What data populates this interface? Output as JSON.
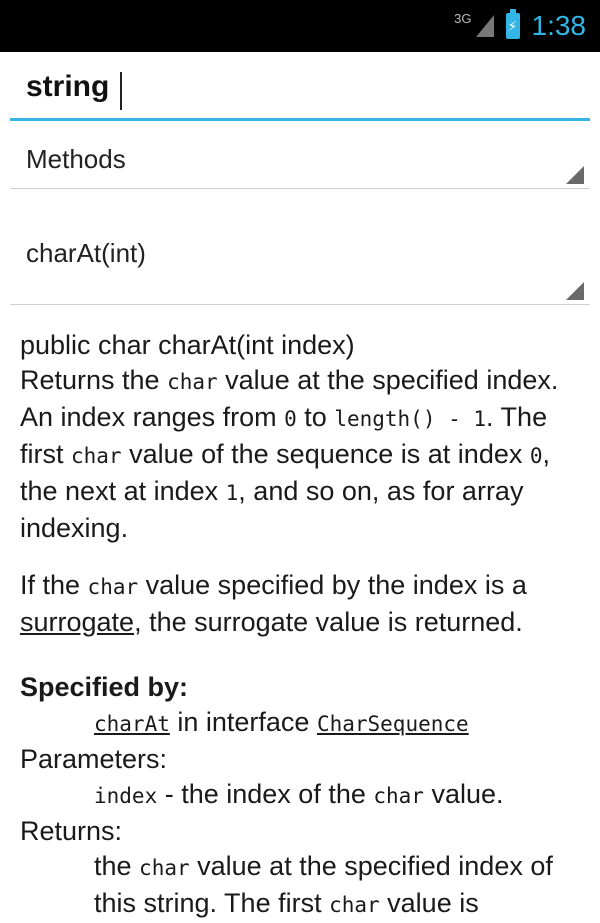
{
  "status_bar": {
    "network": "3G",
    "time": "1:38"
  },
  "search": {
    "value": "string"
  },
  "spinners": {
    "category": "Methods",
    "member": "charAt(int)"
  },
  "doc": {
    "signature": "public char charAt(int index)",
    "p1": {
      "t1": "Returns the ",
      "c1": "char",
      "t2": " value at the specified index. An index ranges from ",
      "c2": "0",
      "t3": " to ",
      "c3": "length() - 1",
      "t4": ". The first ",
      "c4": "char",
      "t5": " value of the sequence is at index ",
      "c5": "0",
      "t6": ", the next at index ",
      "c6": "1",
      "t7": ", and so on, as for array indexing."
    },
    "p2": {
      "t1": "If the ",
      "c1": "char",
      "t2": " value specified by the index is a ",
      "link": "surrogate",
      "t3": ", the surrogate value is returned."
    },
    "specified_by_label": "Specified by:",
    "specified_by": {
      "method": "charAt",
      "mid": " in interface ",
      "iface": "CharSequence"
    },
    "parameters_label": "Parameters:",
    "parameter": {
      "name": "index",
      "desc": " - the index of the ",
      "code": "char",
      "end": " value."
    },
    "returns_label": "Returns:",
    "returns": {
      "t1": "the ",
      "code": "char",
      "t2": " value at the specified index of this string. The first ",
      "code2": "char",
      "t3": " value is"
    }
  }
}
